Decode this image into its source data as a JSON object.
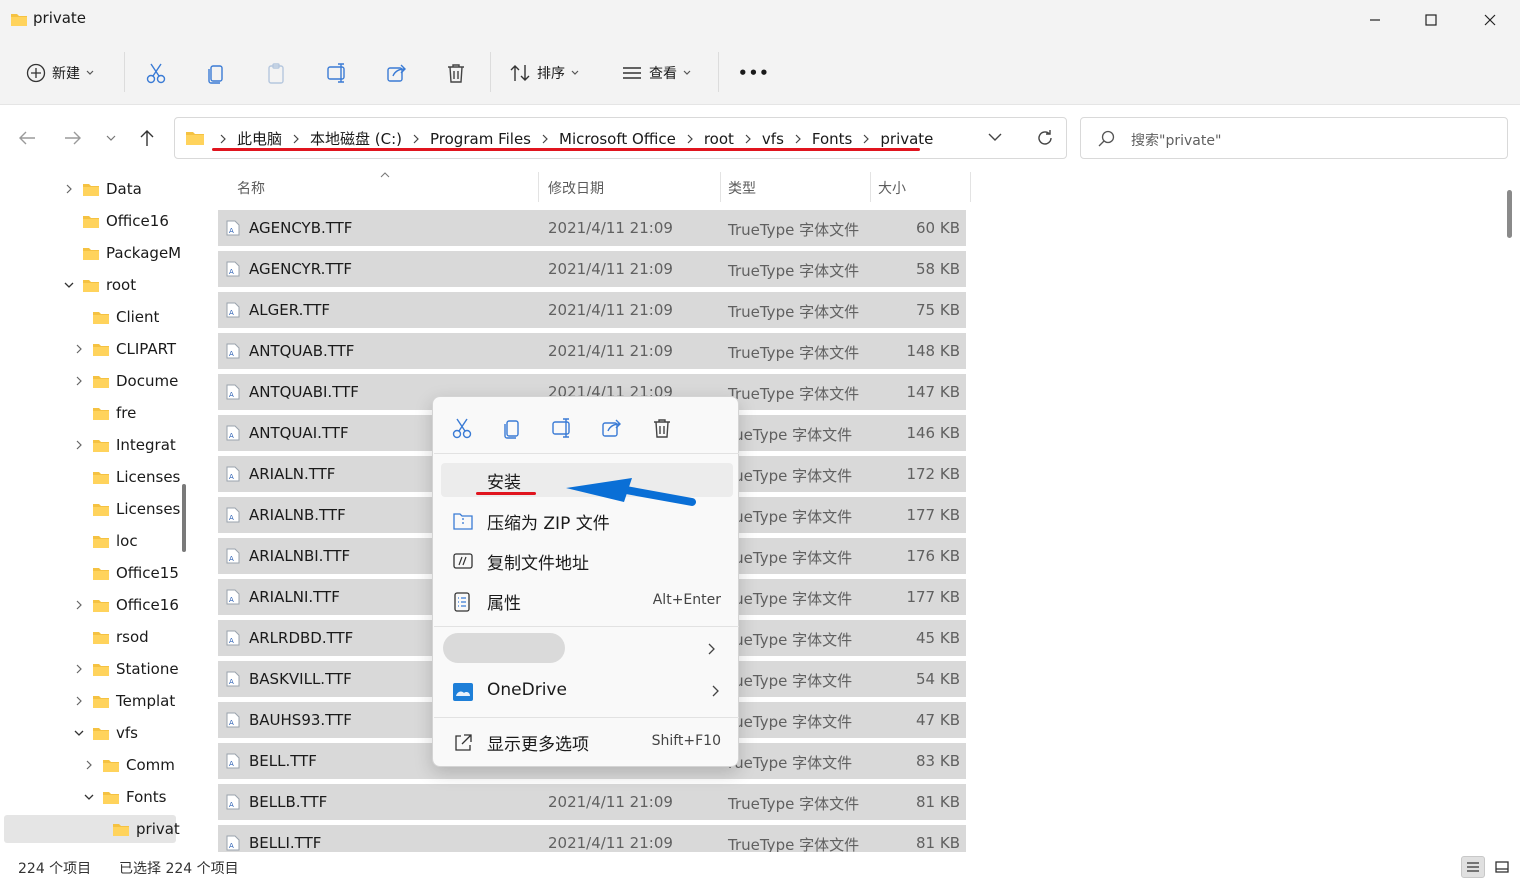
{
  "window": {
    "title": "private"
  },
  "toolbar": {
    "new_label": "新建",
    "sort_label": "排序",
    "view_label": "查看",
    "more_label": "•••"
  },
  "address": {
    "crumbs": [
      "此电脑",
      "本地磁盘 (C:)",
      "Program Files",
      "Microsoft Office",
      "root",
      "vfs",
      "Fonts",
      "private"
    ],
    "search_placeholder": "搜索\"private\""
  },
  "nav": {
    "items": [
      {
        "label": "Data",
        "expander": "collapsed"
      },
      {
        "label": "Office16",
        "expander": "none"
      },
      {
        "label": "PackageM",
        "expander": "none"
      },
      {
        "label": "root",
        "expander": "expanded"
      },
      {
        "label": "Client",
        "expander": "none"
      },
      {
        "label": "CLIPART",
        "expander": "collapsed"
      },
      {
        "label": "Docume",
        "expander": "collapsed"
      },
      {
        "label": "fre",
        "expander": "none"
      },
      {
        "label": "Integrat",
        "expander": "collapsed"
      },
      {
        "label": "Licenses",
        "expander": "none"
      },
      {
        "label": "Licenses",
        "expander": "none"
      },
      {
        "label": "loc",
        "expander": "none"
      },
      {
        "label": "Office15",
        "expander": "none"
      },
      {
        "label": "Office16",
        "expander": "collapsed"
      },
      {
        "label": "rsod",
        "expander": "none"
      },
      {
        "label": "Statione",
        "expander": "collapsed"
      },
      {
        "label": "Templat",
        "expander": "collapsed"
      },
      {
        "label": "vfs",
        "expander": "expanded"
      },
      {
        "label": "Comm",
        "expander": "collapsed"
      },
      {
        "label": "Fonts",
        "expander": "expanded"
      },
      {
        "label": "privat",
        "expander": "none",
        "selected": true
      }
    ]
  },
  "columns": {
    "name": "名称",
    "date": "修改日期",
    "type": "类型",
    "size": "大小"
  },
  "files": [
    {
      "name": "AGENCYB.TTF",
      "date": "2021/4/11 21:09",
      "type": "TrueType 字体文件",
      "size": "60 KB"
    },
    {
      "name": "AGENCYR.TTF",
      "date": "2021/4/11 21:09",
      "type": "TrueType 字体文件",
      "size": "58 KB"
    },
    {
      "name": "ALGER.TTF",
      "date": "2021/4/11 21:09",
      "type": "TrueType 字体文件",
      "size": "75 KB"
    },
    {
      "name": "ANTQUAB.TTF",
      "date": "2021/4/11 21:09",
      "type": "TrueType 字体文件",
      "size": "148 KB"
    },
    {
      "name": "ANTQUABI.TTF",
      "date": "2021/4/11 21:09",
      "type": "TrueType 字体文件",
      "size": "147 KB"
    },
    {
      "name": "ANTQUAI.TTF",
      "date": "",
      "type": "rueType 字体文件",
      "size": "146 KB"
    },
    {
      "name": "ARIALN.TTF",
      "date": "",
      "type": "rueType 字体文件",
      "size": "172 KB"
    },
    {
      "name": "ARIALNB.TTF",
      "date": "",
      "type": "rueType 字体文件",
      "size": "177 KB"
    },
    {
      "name": "ARIALNBI.TTF",
      "date": "",
      "type": "rueType 字体文件",
      "size": "176 KB"
    },
    {
      "name": "ARIALNI.TTF",
      "date": "",
      "type": "rueType 字体文件",
      "size": "177 KB"
    },
    {
      "name": "ARLRDBD.TTF",
      "date": "",
      "type": "rueType 字体文件",
      "size": "45 KB"
    },
    {
      "name": "BASKVILL.TTF",
      "date": "",
      "type": "rueType 字体文件",
      "size": "54 KB"
    },
    {
      "name": "BAUHS93.TTF",
      "date": "",
      "type": "rueType 字体文件",
      "size": "47 KB"
    },
    {
      "name": "BELL.TTF",
      "date": "",
      "type": "rueType 字体文件",
      "size": "83 KB"
    },
    {
      "name": "BELLB.TTF",
      "date": "2021/4/11 21:09",
      "type": "TrueType 字体文件",
      "size": "81 KB"
    },
    {
      "name": "BELLI.TTF",
      "date": "2021/4/11 21:09",
      "type": "TrueType 字体文件",
      "size": "81 KB"
    }
  ],
  "context_menu": {
    "install": "安装",
    "zip": "压缩为 ZIP 文件",
    "copy_path": "复制文件地址",
    "properties": "属性",
    "properties_shortcut": "Alt+Enter",
    "onedrive": "OneDrive",
    "more_options": "显示更多选项",
    "more_shortcut": "Shift+F10"
  },
  "status": {
    "count": "224 个项目",
    "selected": "已选择 224 个项目"
  },
  "colors": {
    "accent": "#0067c0",
    "annotation_red": "#e0141e",
    "folder": "#f5c242",
    "selection": "#d9d9d9"
  }
}
